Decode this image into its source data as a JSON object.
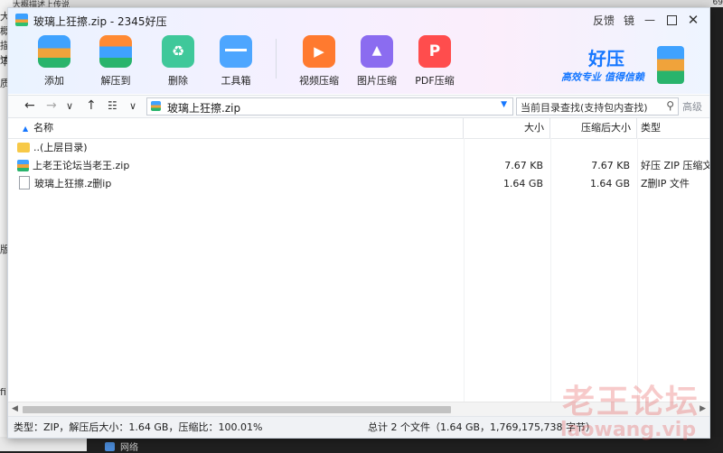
{
  "background": {
    "left_texts": [
      "大概描述",
      "下",
      "质",
      "版",
      "fi"
    ],
    "top_text": "大概描述上传说",
    "top_right": "69",
    "taskbar_item": "网络"
  },
  "window": {
    "title": "玻璃上狂擦.zip - 2345好压",
    "controls": {
      "feedback": "反馈",
      "skin": "镜"
    }
  },
  "toolbar": {
    "items": [
      {
        "label": "添加",
        "icon": "add-archive-icon"
      },
      {
        "label": "解压到",
        "icon": "extract-to-icon"
      },
      {
        "label": "删除",
        "icon": "recycle-delete-icon"
      },
      {
        "label": "工具箱",
        "icon": "toolbox-icon"
      },
      {
        "label": "视频压缩",
        "icon": "video-compress-icon"
      },
      {
        "label": "图片压缩",
        "icon": "image-compress-icon"
      },
      {
        "label": "PDF压缩",
        "icon": "pdf-compress-icon"
      }
    ]
  },
  "brand": {
    "name": "好压",
    "slogan": "高效专业 值得信赖"
  },
  "nav": {
    "path": "玻璃上狂擦.zip",
    "search_placeholder": "当前目录查找(支持包内查找)",
    "advanced": "高级"
  },
  "table": {
    "columns": {
      "name": "名称",
      "size": "大小",
      "packed": "压缩后大小",
      "type": "类型"
    },
    "rows": [
      {
        "name": "..(上层目录)",
        "size": "",
        "packed": "",
        "type": "",
        "icon": "folder-icon"
      },
      {
        "name": "上老王论坛当老王.zip",
        "size": "7.67 KB",
        "packed": "7.67 KB",
        "type": "好压 ZIP 压缩文",
        "icon": "zip-file-icon"
      },
      {
        "name": "玻璃上狂擦.z删ip",
        "size": "1.64 GB",
        "packed": "1.64 GB",
        "type": "Z删IP 文件",
        "icon": "document-icon"
      }
    ]
  },
  "status": {
    "left": "类型：ZIP，解压后大小：1.64 GB，压缩比：100.01%",
    "right": "总计 2 个文件（1.64 GB，1,769,175,738 字节）"
  },
  "watermark": {
    "line1": "老王论坛",
    "line2": "laowang.vip"
  }
}
